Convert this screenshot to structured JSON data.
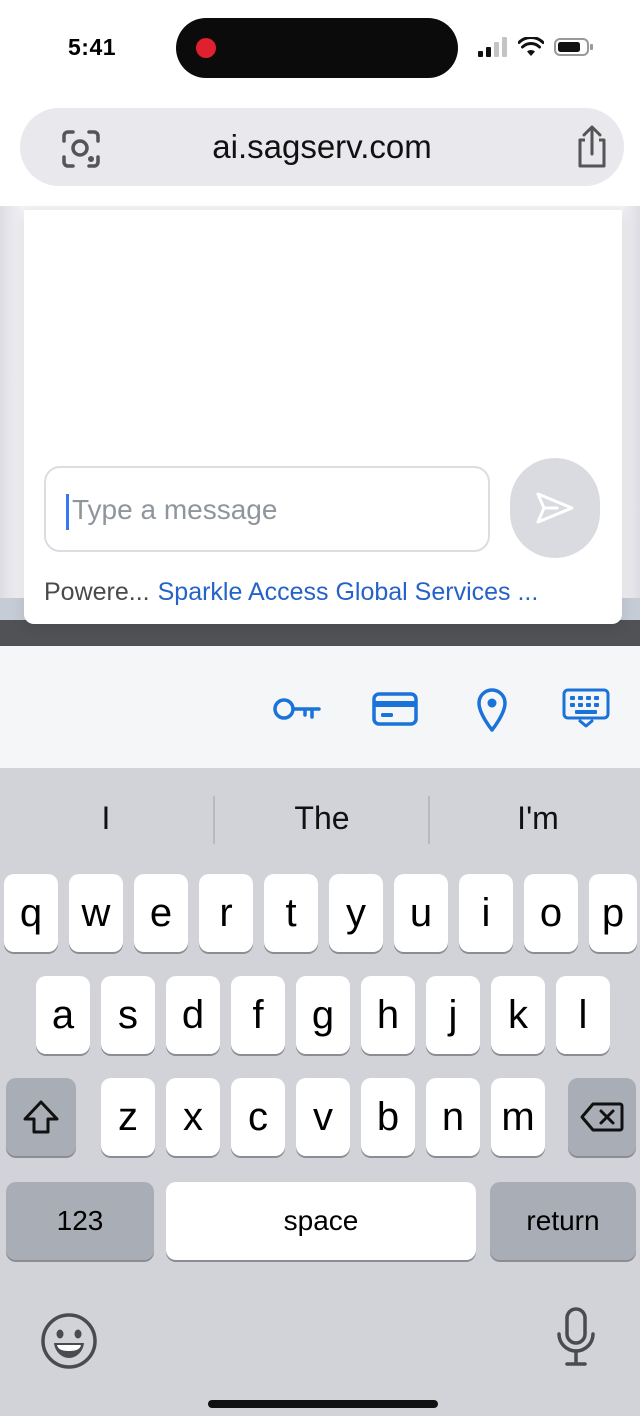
{
  "status_bar": {
    "time": "5:41"
  },
  "browser": {
    "url": "ai.sagserv.com"
  },
  "chat": {
    "input_placeholder": "Type a message",
    "powered_by": "Powere...",
    "provider_link": "Sparkle Access Global Services ..."
  },
  "colors": {
    "link_blue": "#2563c9",
    "autofill_blue": "#1a73d9",
    "send_button_bg": "#d9dbe0",
    "record_dot": "#e0202c"
  },
  "autofill_icons": [
    "key-icon",
    "credit-card-icon",
    "location-pin-icon",
    "keyboard-icon"
  ],
  "keyboard": {
    "suggestions": [
      "I",
      "The",
      "I'm"
    ],
    "row1": [
      "q",
      "w",
      "e",
      "r",
      "t",
      "y",
      "u",
      "i",
      "o",
      "p"
    ],
    "row2": [
      "a",
      "s",
      "d",
      "f",
      "g",
      "h",
      "j",
      "k",
      "l"
    ],
    "row3": [
      "z",
      "x",
      "c",
      "v",
      "b",
      "n",
      "m"
    ],
    "numbers_label": "123",
    "space_label": "space",
    "return_label": "return"
  }
}
